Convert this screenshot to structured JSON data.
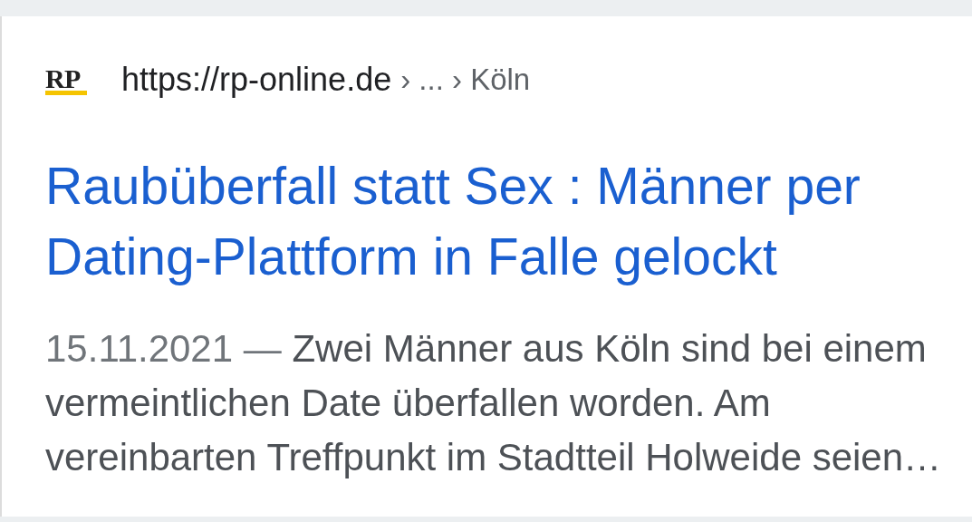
{
  "source": {
    "logo": "RP",
    "url": "https://rp-online.de",
    "breadcrumb": "› ... › Köln"
  },
  "title": "Raubüberfall statt Sex : Männer per Dating-Plattform in Falle gelockt",
  "snippet": {
    "date": "15.11.2021 —",
    "text": "Zwei Männer aus Köln sind bei einem vermeintlichen Date überfallen worden. Am vereinbarten Treffpunkt im Stadtteil Holweide seien…"
  }
}
